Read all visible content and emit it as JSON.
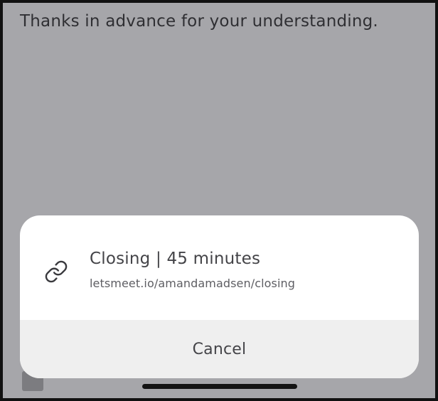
{
  "background": {
    "message_text": "Thanks in advance for your understanding."
  },
  "sheet": {
    "option": {
      "icon": "link-icon",
      "title": "Closing | 45 minutes",
      "url": "letsmeet.io/amandamadsen/closing"
    },
    "cancel_label": "Cancel"
  },
  "colors": {
    "overlay": "#a6a6aa",
    "sheet_bg": "#ffffff",
    "cancel_bg": "#efefef",
    "text_primary": "#444448"
  }
}
